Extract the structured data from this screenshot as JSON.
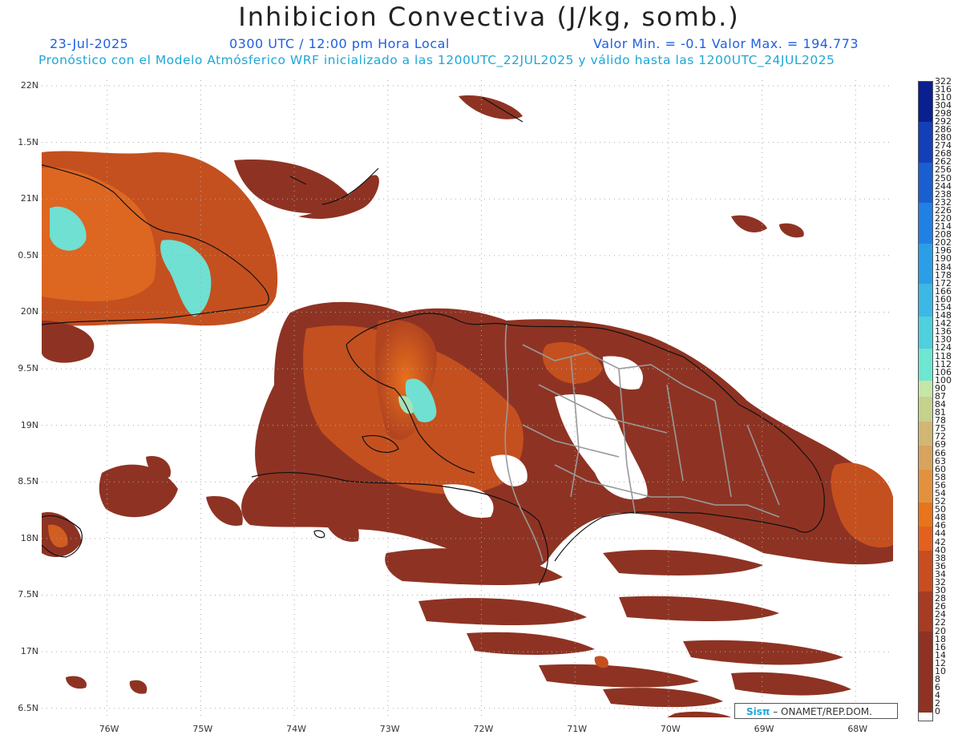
{
  "title": "Inhibicion Convectiva (J/kg, somb.)",
  "date": "23-Jul-2025",
  "time": "0300 UTC / 12:00 pm Hora Local",
  "minmax": "Valor Min. = -0.1  Valor Max. = 194.773",
  "forecast_info": "Pronóstico con el Modelo Atmósferico WRF inicializado a las 1200UTC_22JUL2025 y válido hasta las  1200UTC_24JUL2025",
  "credit_logo": "Sisπ",
  "credit_text": "– ONAMET/REP.DOM.",
  "map": {
    "lon_range": [
      -76.7,
      -67.6
    ],
    "lat_range": [
      16.42,
      22.05
    ],
    "lat_labels": [
      "22N",
      "1.5N",
      "21N",
      "0.5N",
      "20N",
      "9.5N",
      "19N",
      "8.5N",
      "18N",
      "7.5N",
      "17N",
      "6.5N"
    ],
    "lat_values": [
      22,
      21.5,
      21,
      20.5,
      20,
      19.5,
      19,
      18.5,
      18,
      17.5,
      17,
      16.5
    ],
    "lon_labels": [
      "76W",
      "75W",
      "74W",
      "73W",
      "72W",
      "71W",
      "70W",
      "69W",
      "68W"
    ],
    "lon_values": [
      -76,
      -75,
      -74,
      -73,
      -72,
      -71,
      -70,
      -69,
      -68
    ],
    "colors": {
      "low": "#8e3323",
      "mid": "#c4501f",
      "high": "#e86a1c",
      "cyan": "#6fe0d2",
      "teal": "#a8e0b8",
      "coast": "#111111",
      "border": "#999999",
      "grid": "#aaaaaa"
    }
  },
  "colorbar": {
    "labels": [
      "322",
      "316",
      "310",
      "304",
      "298",
      "292",
      "286",
      "280",
      "274",
      "268",
      "262",
      "256",
      "250",
      "244",
      "238",
      "232",
      "226",
      "220",
      "214",
      "208",
      "202",
      "196",
      "190",
      "184",
      "178",
      "172",
      "166",
      "160",
      "154",
      "148",
      "142",
      "136",
      "130",
      "124",
      "118",
      "112",
      "106",
      "100",
      "90",
      "87",
      "84",
      "81",
      "78",
      "75",
      "72",
      "69",
      "66",
      "63",
      "60",
      "58",
      "56",
      "54",
      "52",
      "50",
      "48",
      "46",
      "44",
      "42",
      "40",
      "38",
      "36",
      "34",
      "32",
      "30",
      "28",
      "26",
      "24",
      "22",
      "20",
      "18",
      "16",
      "14",
      "12",
      "10",
      "8",
      "6",
      "4",
      "2",
      "0"
    ]
  }
}
